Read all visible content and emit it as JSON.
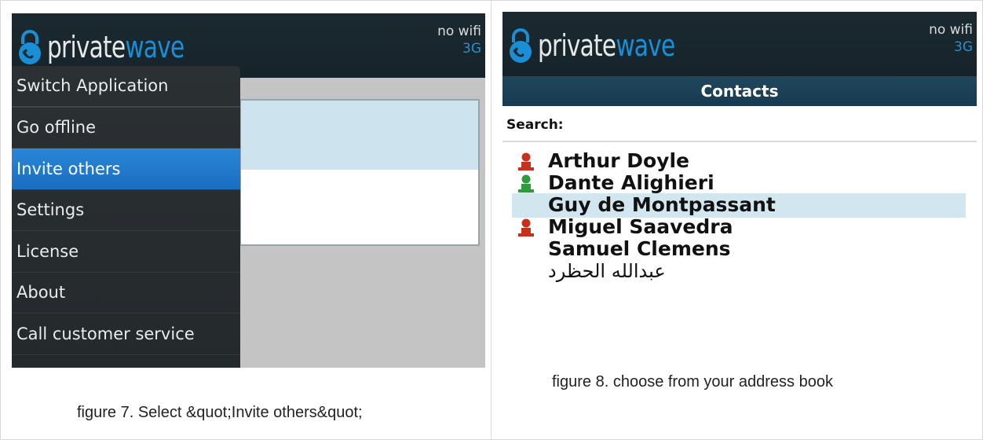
{
  "left_screen": {
    "brand": {
      "word1": "private",
      "word2": "wave"
    },
    "status": {
      "wifi": "no wifi",
      "network": "3G"
    },
    "menu": [
      {
        "label": "Switch Application",
        "active": false
      },
      {
        "label": "Go offline",
        "active": false
      },
      {
        "label": "Invite others",
        "active": true
      },
      {
        "label": "Settings",
        "active": false
      },
      {
        "label": "License",
        "active": false
      },
      {
        "label": "About",
        "active": false
      },
      {
        "label": "Call customer service",
        "active": false
      }
    ],
    "caption": "figure 7. Select &quot;Invite others&quot;"
  },
  "right_screen": {
    "brand": {
      "word1": "private",
      "word2": "wave"
    },
    "status": {
      "wifi": "no wifi",
      "network": "3G"
    },
    "title": "Contacts",
    "search_label": "Search:",
    "contacts": [
      {
        "name": "Arthur Doyle",
        "status_icon": "person-red-icon",
        "selected": false
      },
      {
        "name": "Dante Alighieri",
        "status_icon": "person-green-icon",
        "selected": false
      },
      {
        "name": "Guy de Montpassant",
        "status_icon": "",
        "selected": true
      },
      {
        "name": "Miguel Saavedra",
        "status_icon": "person-red-icon",
        "selected": false
      },
      {
        "name": "Samuel Clemens",
        "status_icon": "",
        "selected": false
      },
      {
        "name": "عبدالله الحظرد",
        "status_icon": "",
        "selected": false
      }
    ],
    "caption": "figure 8. choose from your address book"
  },
  "colors": {
    "titlebar": "#1b2a30",
    "brand_blue": "#1a8fd6",
    "menu_active": "#2a86d7",
    "contacts_bar": "#1f4358",
    "selection": "#d2e6f0",
    "status_red": "#c8301e",
    "status_green": "#2e9b3c"
  }
}
